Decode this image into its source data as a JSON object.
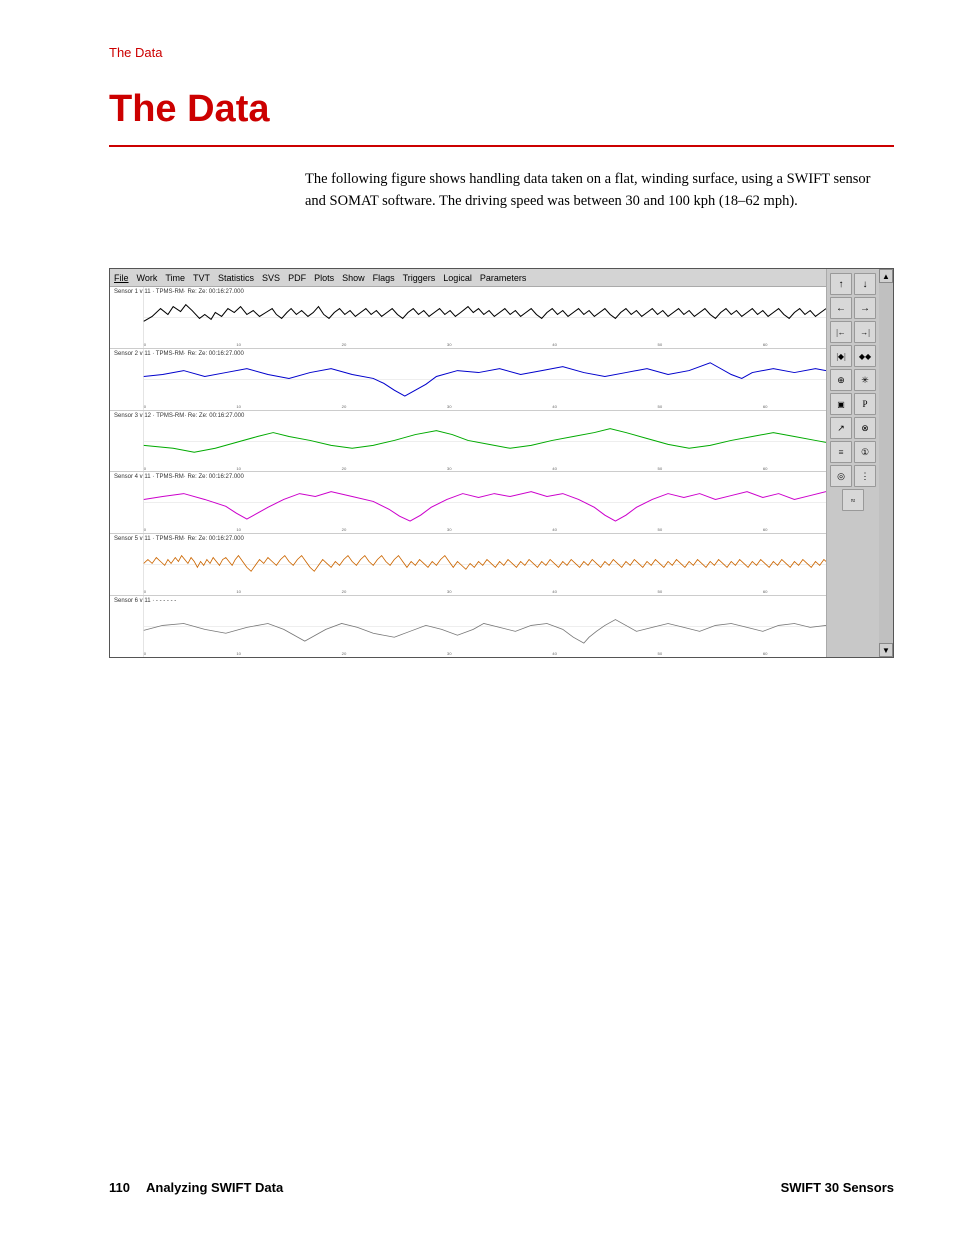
{
  "breadcrumb": {
    "label": "The Data"
  },
  "page_title": "The Data",
  "body_text": "The following figure shows handling data taken on a flat, winding surface, using a SWIFT sensor and SOMAT software. The driving speed was between 30 and 100 kph (18–62 mph).",
  "screenshot": {
    "menu_items": [
      "File",
      "Work",
      "Time",
      "TVT",
      "Statistics",
      "SVS",
      "PDF",
      "Plots",
      "Show",
      "Flags",
      "Triggers",
      "Logical",
      "Parameters"
    ],
    "chart_colors": [
      "#000000",
      "#0000ff",
      "#00aa00",
      "#cc00cc",
      "#cc6600",
      "#888888"
    ],
    "toolbar_buttons": [
      {
        "icon": "↑",
        "name": "up-arrow"
      },
      {
        "icon": "↓",
        "name": "down-arrow"
      },
      {
        "icon": "←",
        "name": "left-arrow"
      },
      {
        "icon": "→",
        "name": "right-arrow"
      },
      {
        "icon": "|←",
        "name": "start"
      },
      {
        "icon": "→|",
        "name": "end"
      },
      {
        "icon": "|◆|",
        "name": "fit"
      },
      {
        "icon": "◆◆",
        "name": "expand"
      },
      {
        "icon": "🔍",
        "name": "zoom-in"
      },
      {
        "icon": "✳",
        "name": "zoom-out"
      },
      {
        "icon": "▣",
        "name": "measure"
      },
      {
        "icon": "P",
        "name": "pin"
      },
      {
        "icon": "↗",
        "name": "cursor"
      },
      {
        "icon": "⊗",
        "name": "close"
      },
      {
        "icon": "≡",
        "name": "list"
      },
      {
        "icon": "①",
        "name": "copy"
      },
      {
        "icon": "◎",
        "name": "circle"
      },
      {
        "icon": "⋮",
        "name": "more"
      },
      {
        "icon": "≈",
        "name": "wave"
      }
    ]
  },
  "footer": {
    "page_number": "110",
    "section": "Analyzing SWIFT Data",
    "product": "SWIFT 30 Sensors"
  }
}
